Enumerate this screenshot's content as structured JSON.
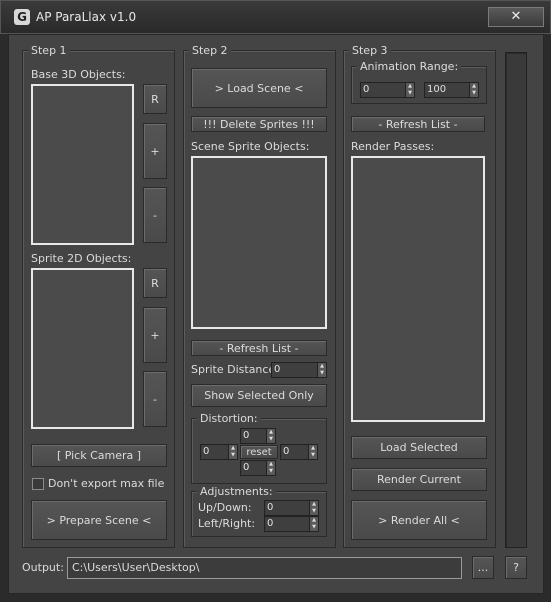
{
  "window": {
    "title": "AP ParaLlax v1.0",
    "close_glyph": "✕",
    "icon_glyph": "G"
  },
  "step1": {
    "title": "Step 1",
    "base_label": "Base 3D Objects:",
    "base_buttons": {
      "r": "R",
      "plus": "+",
      "minus": "-"
    },
    "sprite_label": "Sprite 2D Objects:",
    "sprite_buttons": {
      "r": "R",
      "plus": "+",
      "minus": "-"
    },
    "pick_camera": "[ Pick Camera ]",
    "dont_export": "Don't export max file",
    "prepare_scene": "> Prepare Scene <"
  },
  "step2": {
    "title": "Step 2",
    "load_scene": "> Load Scene <",
    "delete_sprites": "!!! Delete Sprites !!!",
    "scene_sprite_label": "Scene Sprite Objects:",
    "refresh_list": "- Refresh List -",
    "sprite_distance_label": "Sprite Distance:",
    "sprite_distance_value": "0",
    "show_selected": "Show Selected Only",
    "distortion": {
      "title": "Distortion:",
      "top": "0",
      "left": "0",
      "right": "0",
      "bottom": "0",
      "reset": "reset"
    },
    "adjustments": {
      "title": "Adjustments:",
      "updown_label": "Up/Down:",
      "updown_value": "0",
      "leftright_label": "Left/Right:",
      "leftright_value": "0"
    }
  },
  "step3": {
    "title": "Step 3",
    "animation_range": {
      "title": "Animation Range:",
      "start": "0",
      "end": "100"
    },
    "refresh_list": "- Refresh List -",
    "render_passes_label": "Render Passes:",
    "load_selected": "Load Selected",
    "render_current": "Render Current",
    "render_all": "> Render All <"
  },
  "output": {
    "label": "Output:",
    "path": "C:\\Users\\User\\Desktop\\",
    "browse": "...",
    "help": "?"
  },
  "progress": {
    "value": 0
  }
}
